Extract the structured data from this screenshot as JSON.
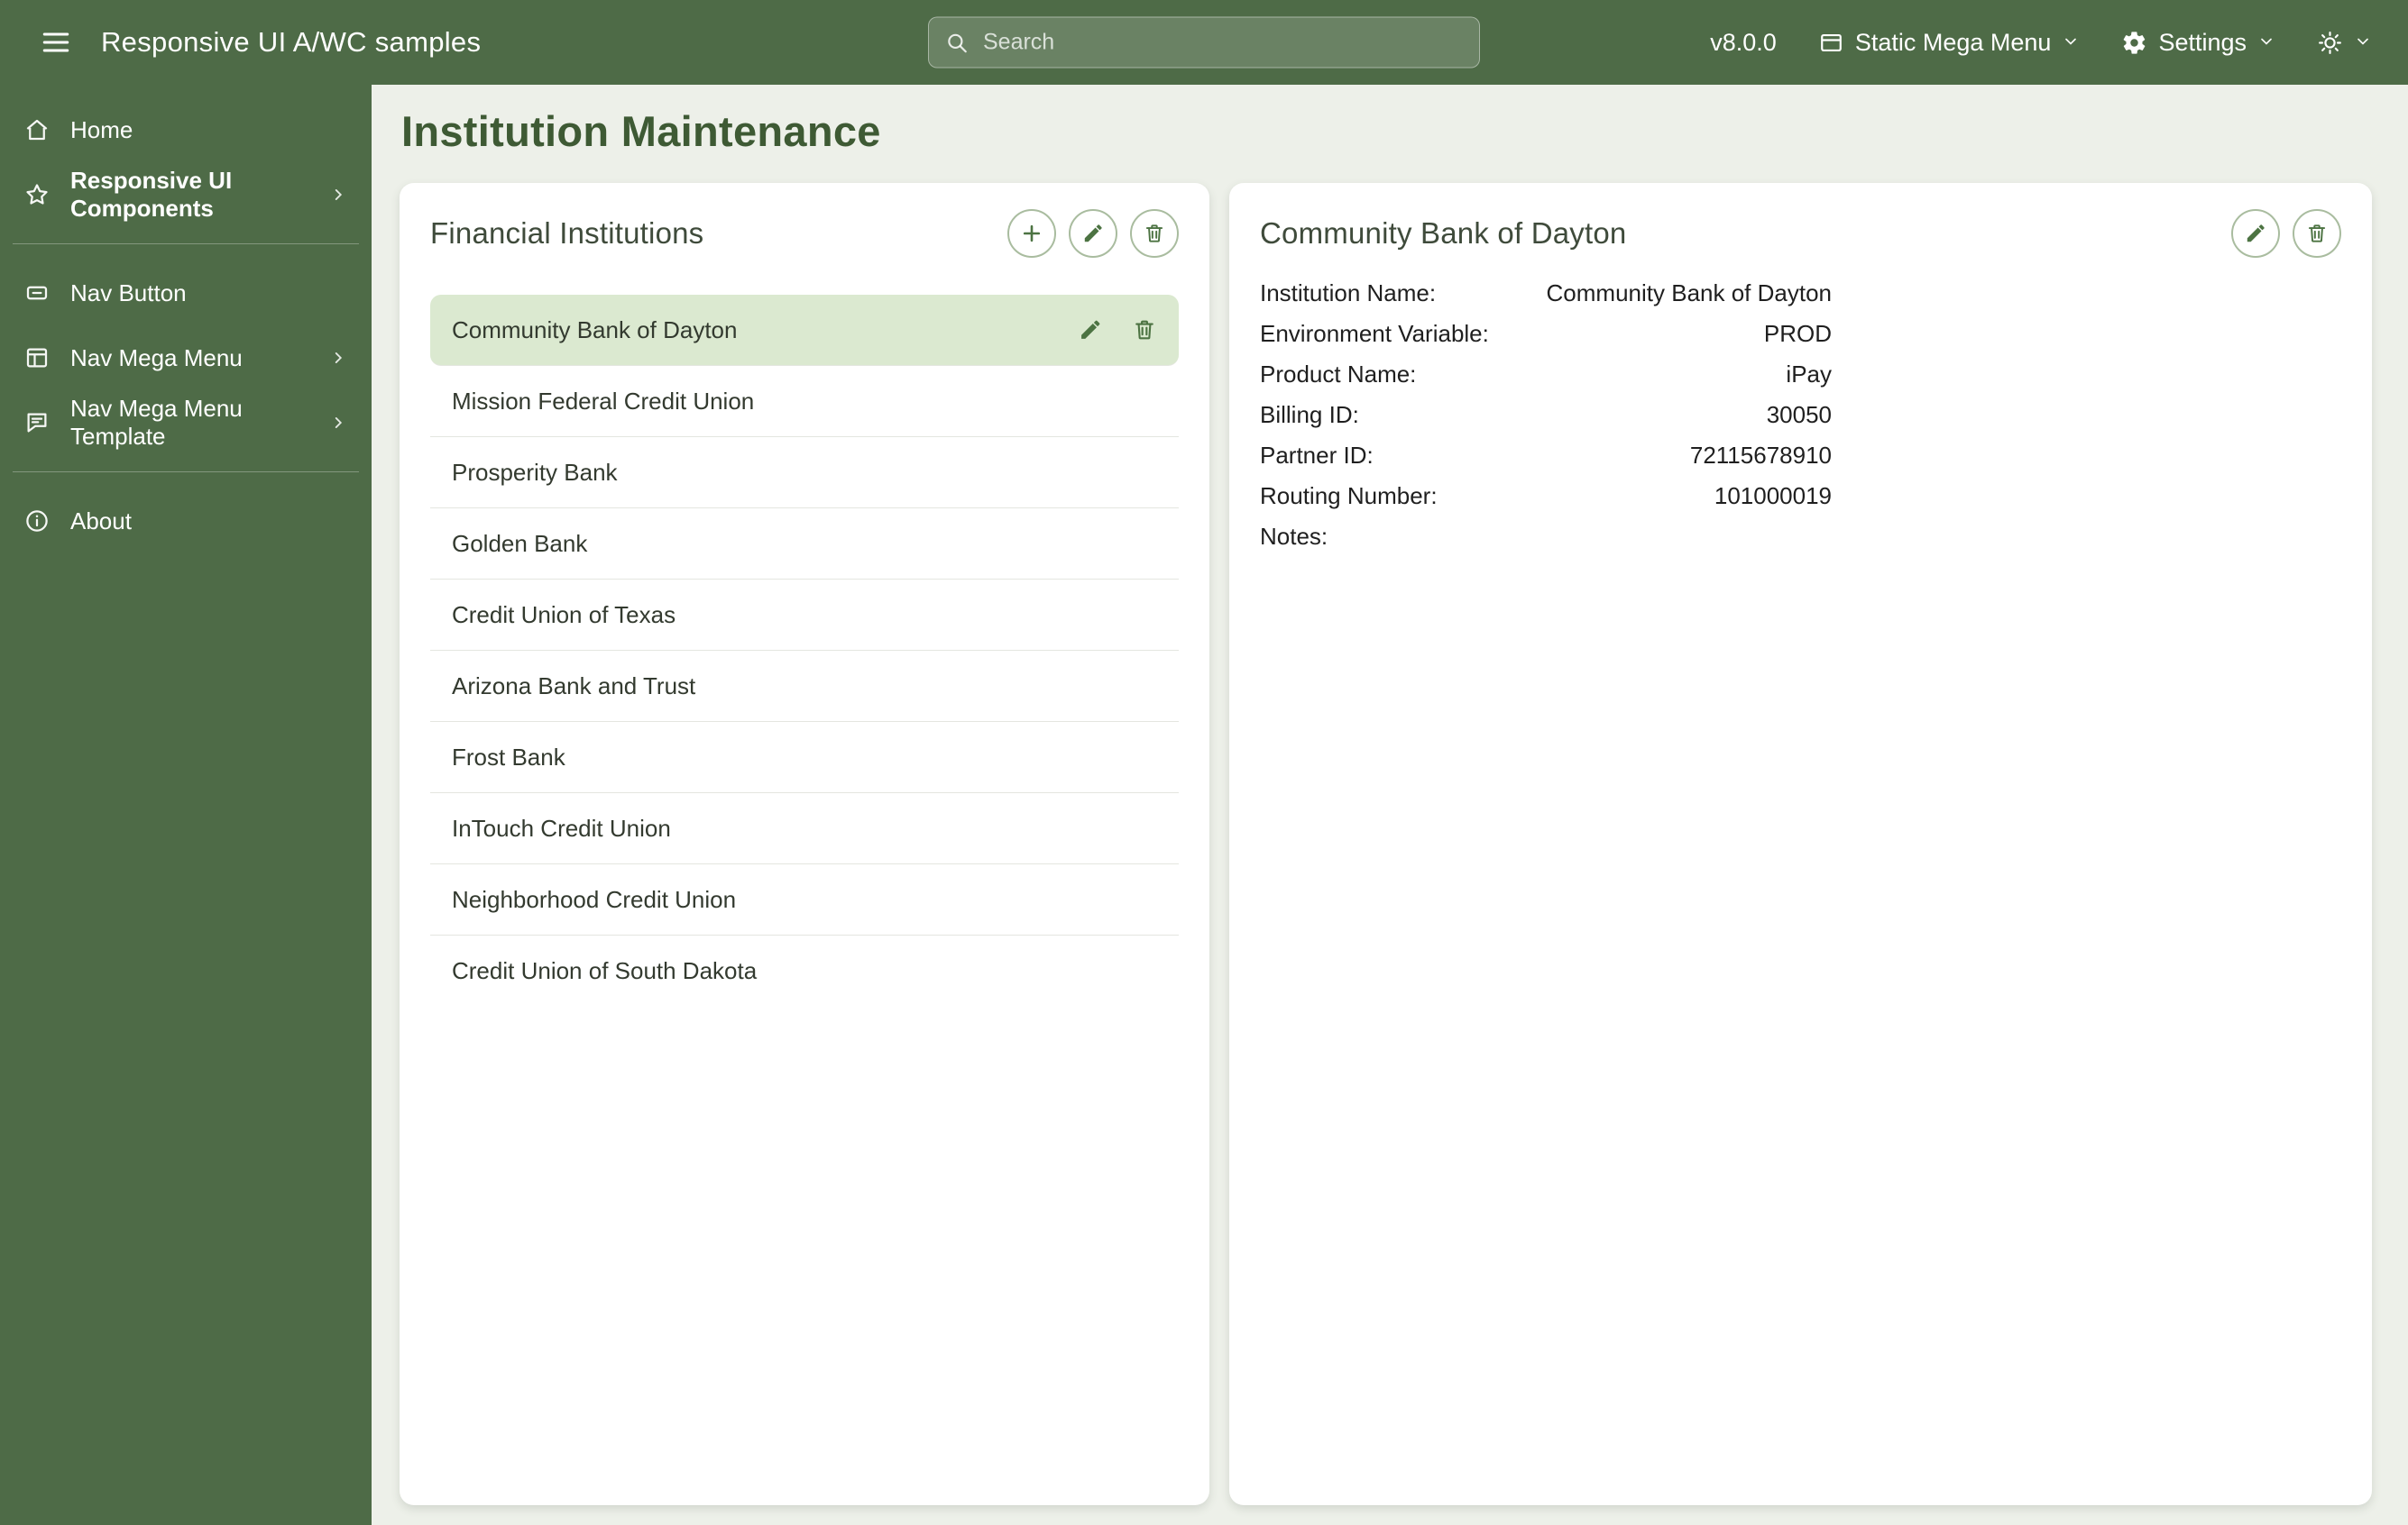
{
  "app": {
    "title": "Responsive UI A/WC samples",
    "version": "v8.0.0"
  },
  "header": {
    "search_placeholder": "Search",
    "mega_menu_label": "Static Mega Menu",
    "settings_label": "Settings"
  },
  "sidebar": {
    "items": [
      {
        "label": "Home",
        "icon": "home-icon"
      },
      {
        "label": "Responsive UI Components",
        "icon": "star-icon",
        "active": true,
        "chevron": true
      },
      {
        "label": "Nav Button",
        "icon": "nav-button-icon"
      },
      {
        "label": "Nav Mega Menu",
        "icon": "nav-mega-menu-icon",
        "chevron": true
      },
      {
        "label": "Nav Mega Menu Template",
        "icon": "nav-mega-menu-template-icon",
        "chevron": true
      },
      {
        "label": "About",
        "icon": "info-icon"
      }
    ]
  },
  "page": {
    "title": "Institution Maintenance"
  },
  "financial_institutions": {
    "title": "Financial Institutions",
    "selected_index": 0,
    "items": [
      "Community Bank of Dayton",
      "Mission Federal Credit Union",
      "Prosperity Bank",
      "Golden Bank",
      "Credit Union of Texas",
      "Arizona Bank and Trust",
      "Frost Bank",
      "InTouch Credit Union",
      "Neighborhood Credit Union",
      "Credit Union of South Dakota"
    ]
  },
  "institution_detail": {
    "title": "Community Bank of Dayton",
    "fields": [
      {
        "label": "Institution Name:",
        "value": "Community Bank of Dayton"
      },
      {
        "label": "Environment Variable:",
        "value": "PROD"
      },
      {
        "label": "Product Name:",
        "value": "iPay"
      },
      {
        "label": "Billing ID:",
        "value": "30050"
      },
      {
        "label": "Partner ID:",
        "value": "72115678910"
      },
      {
        "label": "Routing Number:",
        "value": "101000019"
      },
      {
        "label": "Notes:",
        "value": ""
      }
    ]
  },
  "icons": {
    "hamburger": "menu-lines",
    "search": "magnifier",
    "mega_menu": "window-panel",
    "settings": "gear",
    "theme": "sun",
    "chevron_down": "▾",
    "chevron_right": "›",
    "home": "house",
    "components": "star",
    "nav_button": "button-rect",
    "nav_mega_menu": "window-columns",
    "nav_mega_menu_template": "speech-bubble",
    "about": "info-circle",
    "add": "plus",
    "edit": "pencil",
    "delete": "trash"
  },
  "colors": {
    "header_green": "#4e6b47",
    "accent_green": "#4c7342",
    "title_green": "#3e5a34",
    "selected_row_bg": "#dbe9d0",
    "page_background": "#edf0e9",
    "card_background": "#ffffff"
  }
}
